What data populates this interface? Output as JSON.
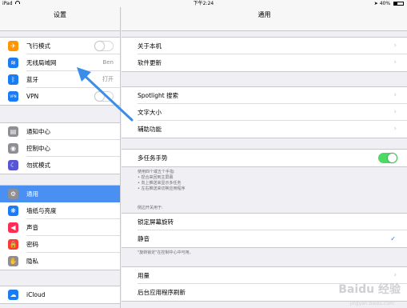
{
  "status_bar": {
    "device": "iPad",
    "time": "下午2:24",
    "battery": "40%",
    "battery_level": 0.4
  },
  "master": {
    "title": "设置",
    "group1": [
      {
        "label": "飞行模式",
        "icon": "airplane-icon",
        "color": "#ff9500",
        "glyph": "✈",
        "control": "toggle",
        "on": false
      },
      {
        "label": "无线局域网",
        "icon": "wifi-icon",
        "color": "#1a7cf4",
        "glyph": "≋",
        "value": "Ben"
      },
      {
        "label": "蓝牙",
        "icon": "bluetooth-icon",
        "color": "#1a7cf4",
        "glyph": "ᛒ",
        "value": "打开"
      },
      {
        "label": "VPN",
        "icon": "vpn-icon",
        "color": "#1a7cf4",
        "glyph": "VPN",
        "control": "toggle",
        "on": false
      }
    ],
    "group2": [
      {
        "label": "通知中心",
        "icon": "notification-icon",
        "color": "#8e8e93",
        "glyph": "▤"
      },
      {
        "label": "控制中心",
        "icon": "control-center-icon",
        "color": "#8e8e93",
        "glyph": "◉"
      },
      {
        "label": "勿扰模式",
        "icon": "moon-icon",
        "color": "#5856d6",
        "glyph": "☾"
      }
    ],
    "group3": [
      {
        "label": "通用",
        "icon": "gear-icon",
        "color": "#8e8e93",
        "glyph": "⚙",
        "selected": true
      },
      {
        "label": "墙纸与亮度",
        "icon": "wallpaper-icon",
        "color": "#1a7cf4",
        "glyph": "❋"
      },
      {
        "label": "声音",
        "icon": "sound-icon",
        "color": "#ff2d55",
        "glyph": "◀"
      },
      {
        "label": "密码",
        "icon": "lock-icon",
        "color": "#ff3b30",
        "glyph": "🔒"
      },
      {
        "label": "隐私",
        "icon": "hand-icon",
        "color": "#8e8e93",
        "glyph": "✋"
      }
    ],
    "group4": [
      {
        "label": "iCloud",
        "icon": "cloud-icon",
        "color": "#1a7cf4",
        "glyph": "☁"
      }
    ]
  },
  "detail": {
    "title": "通用",
    "group1": [
      "关于本机",
      "软件更新"
    ],
    "group2": [
      "Spotlight 搜索",
      "文字大小",
      "辅助功能"
    ],
    "multitask": {
      "label": "多任务手势",
      "on": true
    },
    "multitask_desc": [
      "使用四个或五个手指:",
      "• 捏合来回到主屏幕",
      "• 向上推送来显示多任务",
      "• 左右推送来切换应用程序"
    ],
    "side_switch_header": "侧边开关用于:",
    "side_switch": [
      {
        "label": "锁定屏幕旋转",
        "checked": false
      },
      {
        "label": "静音",
        "checked": true
      }
    ],
    "side_switch_note": "\"旋转锁定\"在控制中心中可用。",
    "group5": [
      "用量",
      "后台应用程序刷新"
    ]
  },
  "watermark": {
    "text": "Baidu 经验",
    "url": "jingyan.baidu.com"
  }
}
